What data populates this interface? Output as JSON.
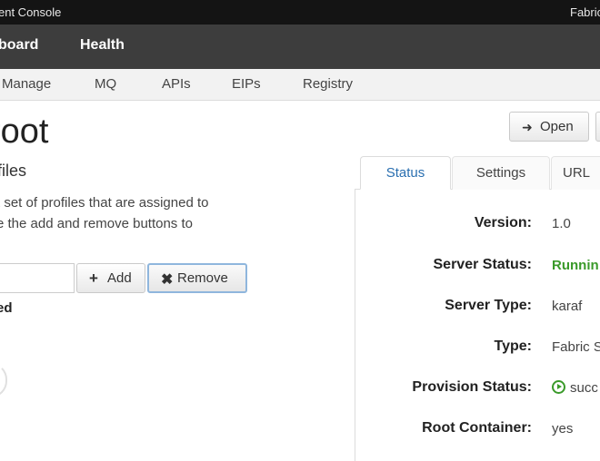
{
  "window": {
    "title_fragment": "ent Console",
    "right_fragment": "Fabric"
  },
  "nav": {
    "items": [
      "board",
      "Health"
    ]
  },
  "subnav": {
    "items": [
      "Manage",
      "MQ",
      "APIs",
      "EIPs",
      "Registry"
    ]
  },
  "page": {
    "title": "root"
  },
  "toolbar": {
    "open_label": "Open"
  },
  "profiles": {
    "title": "files",
    "description_lines": [
      "t set of profiles that are assigned to",
      "e the add and remove buttons to"
    ],
    "add_label": "Add",
    "remove_label": "Remove",
    "input_value": "",
    "assigned_label": "ed"
  },
  "tabs": [
    "Status",
    "Settings",
    "URL"
  ],
  "details": [
    {
      "label": "Version:",
      "value": "1.0"
    },
    {
      "label": "Server Status:",
      "value": "Runnin"
    },
    {
      "label": "Server Type:",
      "value": "karaf"
    },
    {
      "label": "Type:",
      "value": "Fabric S"
    },
    {
      "label": "Provision Status:",
      "value": "succ"
    },
    {
      "label": "Root Container:",
      "value": "yes"
    }
  ],
  "icons": {
    "open": "sign-in-icon",
    "add": "plus-icon",
    "remove": "x-icon",
    "provision": "play-circle-icon"
  },
  "colors": {
    "accent": "#2a6fb0",
    "success": "#3a9a2a",
    "navbar": "#3d3d3d",
    "titlebar": "#141414"
  }
}
